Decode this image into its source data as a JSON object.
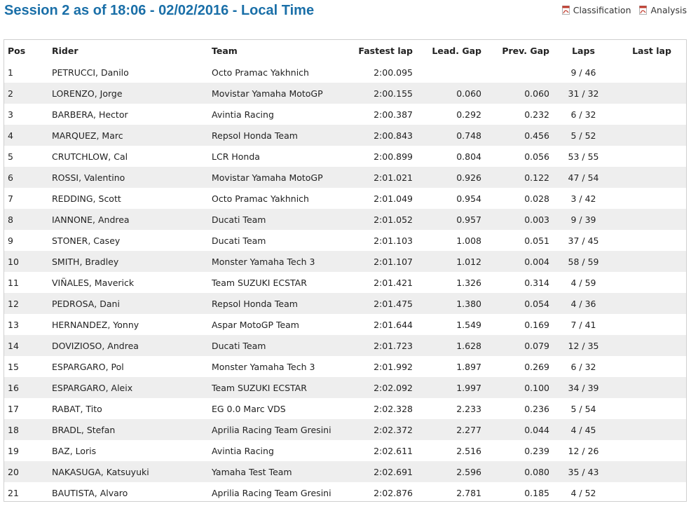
{
  "header": {
    "title": "Session 2 as of 18:06 - 02/02/2016 - Local Time",
    "links": [
      {
        "label": "Classification",
        "icon": "pdf-icon"
      },
      {
        "label": "Analysis",
        "icon": "pdf-icon"
      }
    ]
  },
  "colors": {
    "title": "#1a6fa8",
    "row_alt": "#eeeeee",
    "pdf_icon": "#c0392b"
  },
  "table": {
    "columns": [
      "Pos",
      "Rider",
      "Team",
      "Fastest lap",
      "Lead. Gap",
      "Prev. Gap",
      "Laps",
      "Last lap"
    ],
    "rows": [
      {
        "pos": "1",
        "rider": "PETRUCCI, Danilo",
        "team": "Octo Pramac Yakhnich",
        "fastest": "2:00.095",
        "lead": "",
        "prev": "",
        "laps": "9 / 46",
        "last": ""
      },
      {
        "pos": "2",
        "rider": "LORENZO, Jorge",
        "team": "Movistar Yamaha MotoGP",
        "fastest": "2:00.155",
        "lead": "0.060",
        "prev": "0.060",
        "laps": "31 / 32",
        "last": ""
      },
      {
        "pos": "3",
        "rider": "BARBERA, Hector",
        "team": "Avintia Racing",
        "fastest": "2:00.387",
        "lead": "0.292",
        "prev": "0.232",
        "laps": "6 / 32",
        "last": ""
      },
      {
        "pos": "4",
        "rider": "MARQUEZ, Marc",
        "team": "Repsol Honda Team",
        "fastest": "2:00.843",
        "lead": "0.748",
        "prev": "0.456",
        "laps": "5 / 52",
        "last": ""
      },
      {
        "pos": "5",
        "rider": "CRUTCHLOW, Cal",
        "team": "LCR Honda",
        "fastest": "2:00.899",
        "lead": "0.804",
        "prev": "0.056",
        "laps": "53 / 55",
        "last": ""
      },
      {
        "pos": "6",
        "rider": "ROSSI, Valentino",
        "team": "Movistar Yamaha MotoGP",
        "fastest": "2:01.021",
        "lead": "0.926",
        "prev": "0.122",
        "laps": "47 / 54",
        "last": ""
      },
      {
        "pos": "7",
        "rider": "REDDING, Scott",
        "team": "Octo Pramac Yakhnich",
        "fastest": "2:01.049",
        "lead": "0.954",
        "prev": "0.028",
        "laps": "3 / 42",
        "last": ""
      },
      {
        "pos": "8",
        "rider": "IANNONE, Andrea",
        "team": "Ducati Team",
        "fastest": "2:01.052",
        "lead": "0.957",
        "prev": "0.003",
        "laps": "9 / 39",
        "last": ""
      },
      {
        "pos": "9",
        "rider": "STONER, Casey",
        "team": "Ducati Team",
        "fastest": "2:01.103",
        "lead": "1.008",
        "prev": "0.051",
        "laps": "37 / 45",
        "last": ""
      },
      {
        "pos": "10",
        "rider": "SMITH, Bradley",
        "team": "Monster Yamaha Tech 3",
        "fastest": "2:01.107",
        "lead": "1.012",
        "prev": "0.004",
        "laps": "58 / 59",
        "last": ""
      },
      {
        "pos": "11",
        "rider": "VIÑALES, Maverick",
        "team": "Team SUZUKI ECSTAR",
        "fastest": "2:01.421",
        "lead": "1.326",
        "prev": "0.314",
        "laps": "4 / 59",
        "last": ""
      },
      {
        "pos": "12",
        "rider": "PEDROSA, Dani",
        "team": "Repsol Honda Team",
        "fastest": "2:01.475",
        "lead": "1.380",
        "prev": "0.054",
        "laps": "4 / 36",
        "last": ""
      },
      {
        "pos": "13",
        "rider": "HERNANDEZ, Yonny",
        "team": "Aspar MotoGP Team",
        "fastest": "2:01.644",
        "lead": "1.549",
        "prev": "0.169",
        "laps": "7 / 41",
        "last": ""
      },
      {
        "pos": "14",
        "rider": "DOVIZIOSO, Andrea",
        "team": "Ducati Team",
        "fastest": "2:01.723",
        "lead": "1.628",
        "prev": "0.079",
        "laps": "12 / 35",
        "last": ""
      },
      {
        "pos": "15",
        "rider": "ESPARGARO, Pol",
        "team": "Monster Yamaha Tech 3",
        "fastest": "2:01.992",
        "lead": "1.897",
        "prev": "0.269",
        "laps": "6 / 32",
        "last": ""
      },
      {
        "pos": "16",
        "rider": "ESPARGARO, Aleix",
        "team": "Team SUZUKI ECSTAR",
        "fastest": "2:02.092",
        "lead": "1.997",
        "prev": "0.100",
        "laps": "34 / 39",
        "last": ""
      },
      {
        "pos": "17",
        "rider": "RABAT, Tito",
        "team": "EG 0.0 Marc VDS",
        "fastest": "2:02.328",
        "lead": "2.233",
        "prev": "0.236",
        "laps": "5 / 54",
        "last": ""
      },
      {
        "pos": "18",
        "rider": "BRADL, Stefan",
        "team": "Aprilia Racing Team Gresini",
        "fastest": "2:02.372",
        "lead": "2.277",
        "prev": "0.044",
        "laps": "4 / 45",
        "last": ""
      },
      {
        "pos": "19",
        "rider": "BAZ, Loris",
        "team": "Avintia Racing",
        "fastest": "2:02.611",
        "lead": "2.516",
        "prev": "0.239",
        "laps": "12 / 26",
        "last": ""
      },
      {
        "pos": "20",
        "rider": "NAKASUGA, Katsuyuki",
        "team": "Yamaha Test Team",
        "fastest": "2:02.691",
        "lead": "2.596",
        "prev": "0.080",
        "laps": "35 / 43",
        "last": ""
      },
      {
        "pos": "21",
        "rider": "BAUTISTA, Alvaro",
        "team": "Aprilia Racing Team Gresini",
        "fastest": "2:02.876",
        "lead": "2.781",
        "prev": "0.185",
        "laps": "4 / 52",
        "last": ""
      }
    ]
  }
}
